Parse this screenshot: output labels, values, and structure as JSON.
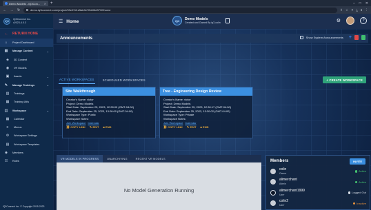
{
  "browser": {
    "tab_title": "Demo Models - iQ3Con...",
    "url": "demo.iq3connect.com/project/33c07d1e5ab0e7fbb06d3730/home"
  },
  "sidebar": {
    "logo_line1": "iQ3Connect Inc.",
    "logo_line2": "v2023-4.0.3",
    "return_home": "RETURN HOME",
    "items": [
      {
        "label": "Project Dashboard",
        "icon": "home-icon",
        "type": "item",
        "active": true
      },
      {
        "label": "Manage Content",
        "icon": "content-icon",
        "type": "group"
      },
      {
        "label": "3D Content",
        "icon": "cube-icon",
        "type": "sub"
      },
      {
        "label": "VR Models",
        "icon": "vr-icon",
        "type": "sub"
      },
      {
        "label": "Assets",
        "icon": "assets-icon",
        "type": "sub"
      },
      {
        "label": "Manage Trainings",
        "icon": "trainings-icon",
        "type": "group"
      },
      {
        "label": "Trainings",
        "icon": "training-icon",
        "type": "sub"
      },
      {
        "label": "Training Utils",
        "icon": "utils-icon",
        "type": "sub"
      },
      {
        "label": "Workspace",
        "icon": "workspace-icon",
        "type": "group"
      },
      {
        "label": "Calendar",
        "icon": "calendar-icon",
        "type": "sub"
      },
      {
        "label": "Menus",
        "icon": "menu-icon",
        "type": "sub"
      },
      {
        "label": "Workspace Settings",
        "icon": "settings-icon",
        "type": "sub"
      },
      {
        "label": "Workspace Templates",
        "icon": "templates-icon",
        "type": "sub"
      },
      {
        "label": "Members",
        "icon": "members-icon",
        "type": "item"
      },
      {
        "label": "Roles",
        "icon": "roles-icon",
        "type": "item"
      }
    ],
    "footer": "iQ3Connect Inc. © Copyright 2015-2023"
  },
  "header": {
    "page_title": "Home",
    "project_badge": "iQ3",
    "project_name": "Demo Models",
    "project_owner": "Created and Owned By iq3-colin"
  },
  "announcements": {
    "title": "Announcements",
    "show_system_label": "Show System Announcements"
  },
  "workspaces": {
    "tab_active": "ACTIVE WORKSPACES",
    "tab_scheduled": "SCHEDULED WORKSPACES",
    "create_label": "+ CREATE WORKSPACE",
    "cards": [
      {
        "title": "Site Walkthrough",
        "creator": "Creator's Name: victor",
        "project": "Project: Demo Models",
        "start": "Start Date: September 25, 2023, 12:28:00 (GMT-04:00)",
        "end": "End Date: September 25, 2023, 13:28:00 (GMT-04:00)",
        "type": "Workspace Type: Public",
        "notes": "Workspace Notes:",
        "join": "Join Workspace",
        "calendar": "Calendar",
        "copy": "COPY LINK",
        "edit": "EDIT",
        "end_label": "END"
      },
      {
        "title": "Tree - Engineering Design Review",
        "creator": "Creator's Name: victor",
        "project": "Project: Demo Models",
        "start": "Start Date: September 25, 2023, 12:30:17 (GMT-04:00)",
        "end": "End Date: September 25, 2023, 13:30:02 (GMT-04:00)",
        "type": "Workspace Type: Private",
        "notes": "Workspace Notes:",
        "join": "Join Workspace",
        "calendar": "Calendar",
        "copy": "COPY LINK",
        "edit": "EDIT",
        "end_label": "END"
      }
    ]
  },
  "model_gen": {
    "tab_progress": "VR MODELS IN PROGRESS",
    "tab_unarchiving": "UNARCHIVING",
    "tab_recent": "RECENT VR MODELS",
    "empty_text": "No Model Generation Running"
  },
  "members": {
    "title": "Members",
    "invite": "INVITE",
    "list": [
      {
        "name": "colin",
        "role": "Owner",
        "status": "Active",
        "status_color": "#46c471"
      },
      {
        "name": "alimerchant",
        "role": "Admin",
        "status": "Active",
        "status_color": "#46c471"
      },
      {
        "name": "alimerchant1999",
        "role": "User",
        "status": "Logged Out",
        "status_color": "#d7dde6"
      },
      {
        "name": "colin2",
        "role": "User",
        "status": "Inactive",
        "status_color": "#e8923b"
      }
    ]
  }
}
